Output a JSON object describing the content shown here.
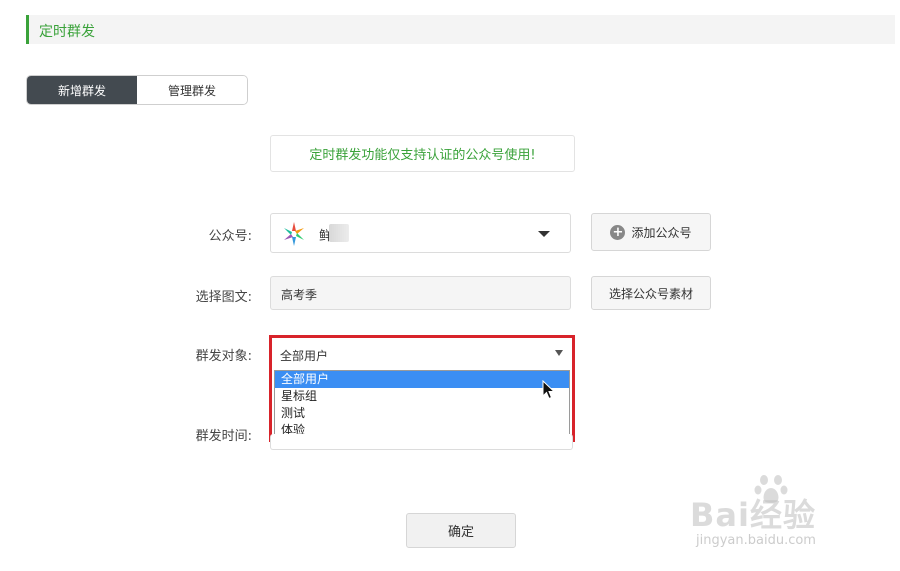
{
  "header": {
    "title": "定时群发"
  },
  "tabs": [
    {
      "label": "新增群发",
      "active": true
    },
    {
      "label": "管理群发",
      "active": false
    }
  ],
  "notice": {
    "text": "定时群发功能仅支持认证的公众号使用!"
  },
  "form": {
    "account": {
      "label": "公众号:",
      "name_visible": "鲜",
      "add_button": "添加公众号"
    },
    "article": {
      "label": "选择图文:",
      "value": "高考季",
      "select_button": "选择公众号素材"
    },
    "target": {
      "label": "群发对象:",
      "selected": "全部用户",
      "options": [
        "全部用户",
        "星标组",
        "测试",
        "体验"
      ]
    },
    "time": {
      "label": "群发时间:"
    }
  },
  "confirm_button": "确定",
  "watermark": {
    "main": "Bai经验",
    "sub": "jingyan.baidu.com"
  },
  "colors": {
    "accent_green": "#3aa23a",
    "tab_active_bg": "#434a50",
    "highlight_red": "#d8232a",
    "selected_blue": "#3b8ef3"
  }
}
